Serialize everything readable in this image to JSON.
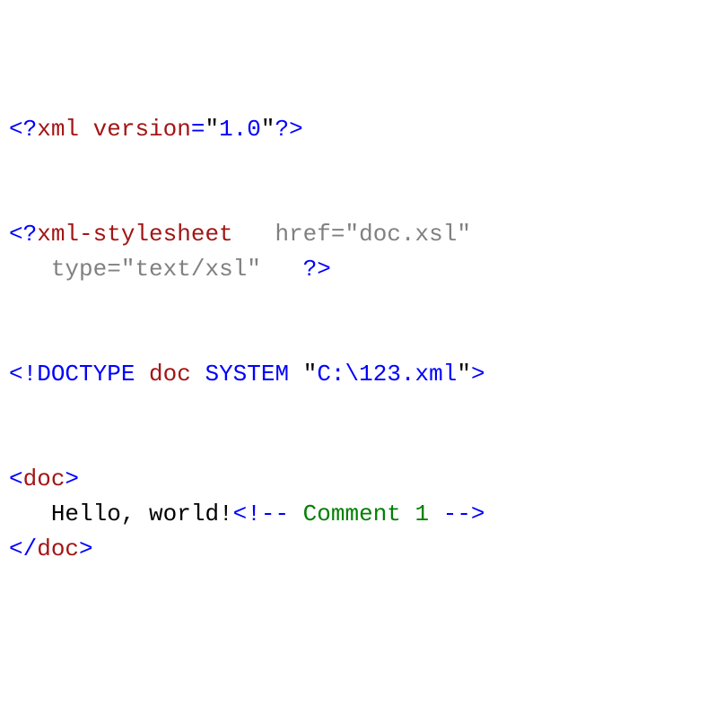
{
  "l1": {
    "open": "<?",
    "name": "xml",
    "attr": "version",
    "eq": "=",
    "q1": "\"",
    "val": "1.0",
    "q2": "\"",
    "close": "?>"
  },
  "l2": {
    "open": "<?",
    "name": "xml-stylesheet",
    "gap1": "   ",
    "attr1": "href",
    "eq1": "=",
    "q1a": "\"",
    "val1": "doc.xsl",
    "q1b": "\""
  },
  "l3": {
    "indent": "   ",
    "attr2": "type",
    "eq2": "=",
    "q2a": "\"",
    "val2": "text/xsl",
    "q2b": "\"",
    "gap2": "   ",
    "close": "?>"
  },
  "l4": {
    "open": "<!",
    "doctype": "DOCTYPE",
    "sp1": " ",
    "root": "doc",
    "sp2": " ",
    "system": "SYSTEM",
    "sp3": " ",
    "q1": "\"",
    "path": "C:\\123.xml",
    "q2": "\"",
    "close": ">"
  },
  "l5": {
    "lt": "<",
    "name": "doc",
    "gt": ">"
  },
  "l6": {
    "indent": "   ",
    "text": "Hello, world!",
    "copen": "<!--",
    "cbody": " Comment 1 ",
    "cclose": "-->"
  },
  "l7": {
    "lt": "</",
    "name": "doc",
    "gt": ">"
  }
}
